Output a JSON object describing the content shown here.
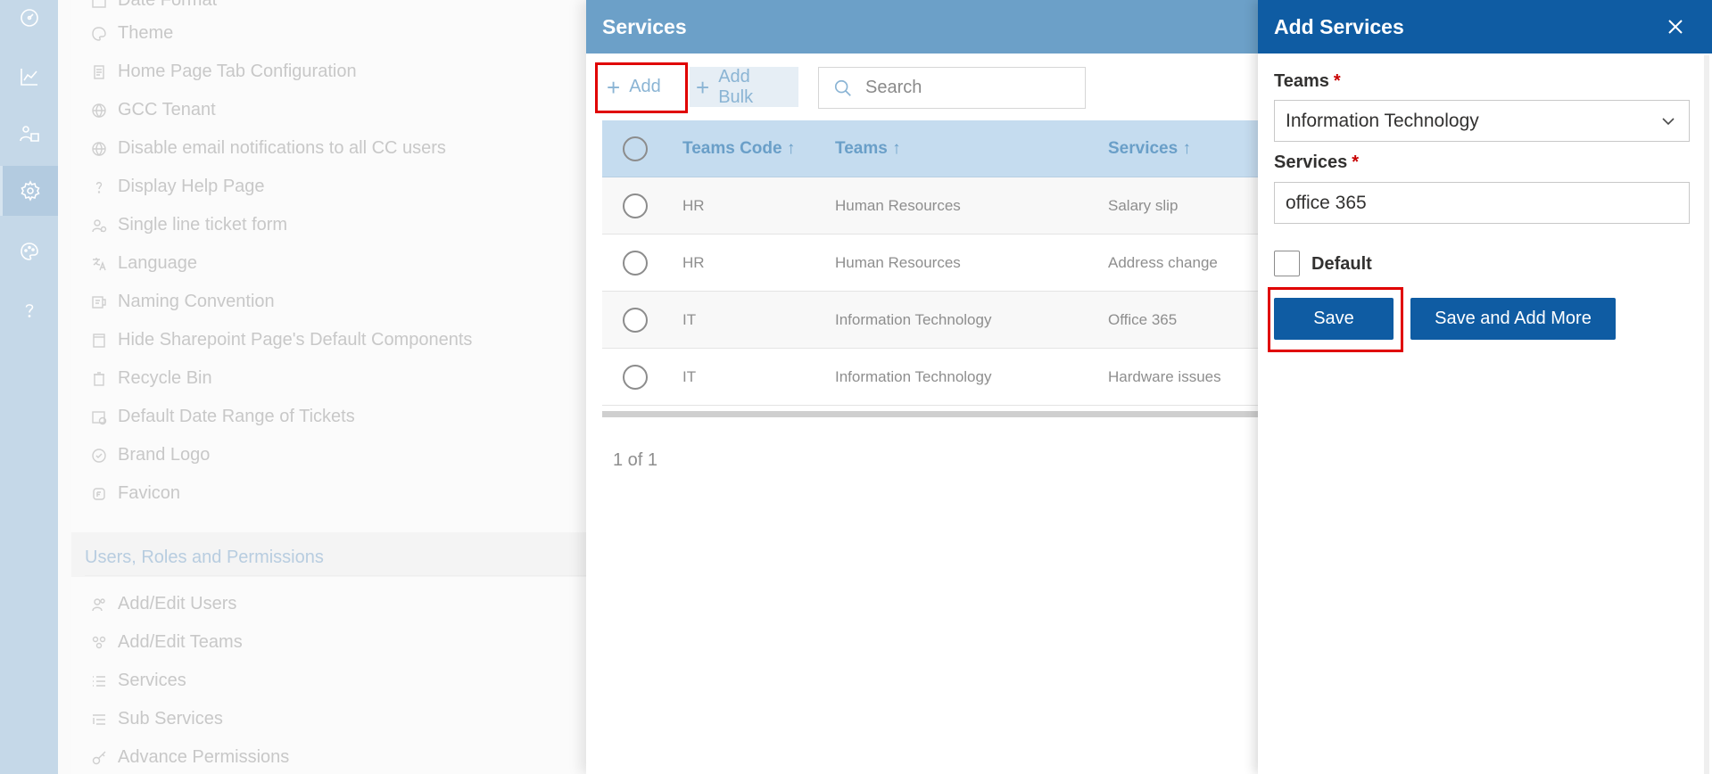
{
  "rail": {
    "icons": [
      "dashboard-icon",
      "analytics-icon",
      "users-icon",
      "settings-icon",
      "palette-icon",
      "help-icon"
    ],
    "active_index": 3
  },
  "settings": {
    "items": [
      {
        "label": "Date Format",
        "icon": "calendar-icon"
      },
      {
        "label": "Theme",
        "icon": "palette-icon"
      },
      {
        "label": "Home Page Tab Configuration",
        "icon": "page-icon"
      },
      {
        "label": "GCC Tenant",
        "icon": "globe-icon"
      },
      {
        "label": "Disable email notifications to all CC users",
        "icon": "globe-icon"
      },
      {
        "label": "Display Help Page",
        "icon": "question-icon"
      },
      {
        "label": "Single line ticket form",
        "icon": "form-icon"
      },
      {
        "label": "Language",
        "icon": "language-icon"
      },
      {
        "label": "Naming Convention",
        "icon": "naming-icon"
      },
      {
        "label": "Hide Sharepoint Page's Default Components",
        "icon": "page-icon"
      },
      {
        "label": "Recycle Bin",
        "icon": "recycle-icon"
      },
      {
        "label": "Default Date Range of Tickets",
        "icon": "calendar-clock-icon"
      },
      {
        "label": "Brand Logo",
        "icon": "badge-icon"
      },
      {
        "label": "Favicon",
        "icon": "favicon-icon"
      }
    ],
    "section_title": "Users, Roles and Permissions",
    "section_items": [
      {
        "label": "Add/Edit Users",
        "icon": "people-icon"
      },
      {
        "label": "Add/Edit Teams",
        "icon": "team-icon"
      },
      {
        "label": "Services",
        "icon": "list-icon"
      },
      {
        "label": "Sub Services",
        "icon": "sublist-icon"
      },
      {
        "label": "Advance Permissions",
        "icon": "key-icon"
      }
    ]
  },
  "services_panel": {
    "title": "Services",
    "add_label": "Add",
    "add_bulk_label": "Add Bulk",
    "search_placeholder": "Search",
    "columns": [
      "Teams Code ↑",
      "Teams ↑",
      "Services ↑"
    ],
    "rows": [
      {
        "code": "HR",
        "team": "Human Resources",
        "service": "Salary slip"
      },
      {
        "code": "HR",
        "team": "Human Resources",
        "service": "Address change"
      },
      {
        "code": "IT",
        "team": "Information Technology",
        "service": "Office 365"
      },
      {
        "code": "IT",
        "team": "Information Technology",
        "service": "Hardware issues"
      }
    ],
    "pager": "1 of 1"
  },
  "dialog": {
    "title": "Add Services",
    "teams_label": "Teams",
    "teams_value": "Information Technology",
    "services_label": "Services",
    "services_value": "office 365",
    "required_marker": "*",
    "default_label": "Default",
    "default_checked": false,
    "save_label": "Save",
    "save_more_label": "Save and Add More"
  },
  "colors": {
    "header_blue": "#0f5ca3",
    "panel_header": "#6ca0c8",
    "rail": "#c5d8e8",
    "highlight": "#e00000"
  }
}
